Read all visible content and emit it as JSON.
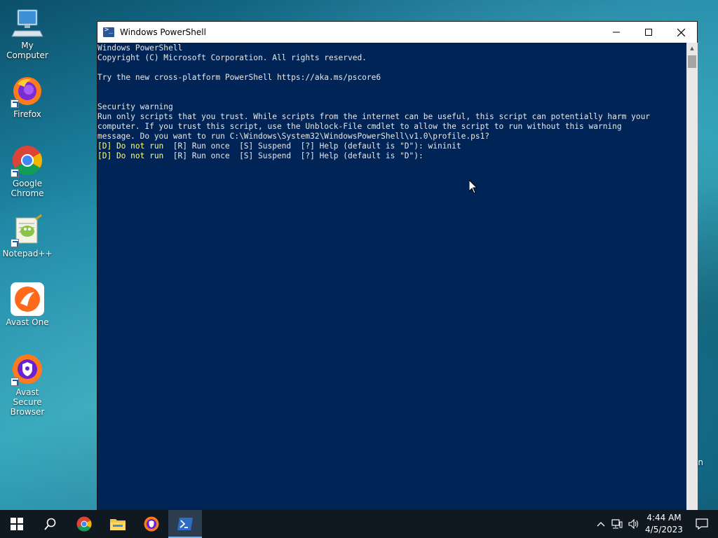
{
  "desktop": {
    "icons": [
      {
        "label": "My Computer",
        "icon": "computer-icon"
      },
      {
        "label": "Firefox",
        "icon": "firefox-icon"
      },
      {
        "label": "Google Chrome",
        "icon": "chrome-icon"
      },
      {
        "label": "Notepad++",
        "icon": "notepadpp-icon"
      },
      {
        "label": "Avast One",
        "icon": "avast-one-icon"
      },
      {
        "label": "Avast Secure Browser",
        "icon": "avast-browser-icon"
      }
    ],
    "partial_label": "in"
  },
  "window": {
    "title": "Windows PowerShell",
    "buttons": {
      "minimize": "—",
      "maximize": "☐",
      "close": "✕"
    }
  },
  "console": {
    "line1": "Windows PowerShell",
    "line2": "Copyright (C) Microsoft Corporation. All rights reserved.",
    "line3": "Try the new cross-platform PowerShell https://aka.ms/pscore6",
    "line4": "Security warning",
    "line5": "Run only scripts that you trust. While scripts from the internet can be useful, this script can potentially harm your",
    "line6": "computer. If you trust this script, use the Unblock-File cmdlet to allow the script to run without this warning",
    "line7": "message. Do you want to run C:\\Windows\\System32\\WindowsPowerShell\\v1.0\\profile.ps1?",
    "prompt1_choice": "[D] Do not run",
    "prompt1_rest": "  [R] Run once  [S] Suspend  [?] Help (default is \"D\"): wininit",
    "prompt2_choice": "[D] Do not run",
    "prompt2_rest": "  [R] Run once  [S] Suspend  [?] Help (default is \"D\"):",
    "prompt_color": "#ffff66",
    "background": "#012456"
  },
  "taskbar": {
    "items": [
      "start-icon",
      "search-icon",
      "chrome-icon",
      "file-explorer-icon",
      "avast-browser-icon",
      "powershell-icon"
    ],
    "time": "4:44 AM",
    "date": "4/5/2023"
  }
}
